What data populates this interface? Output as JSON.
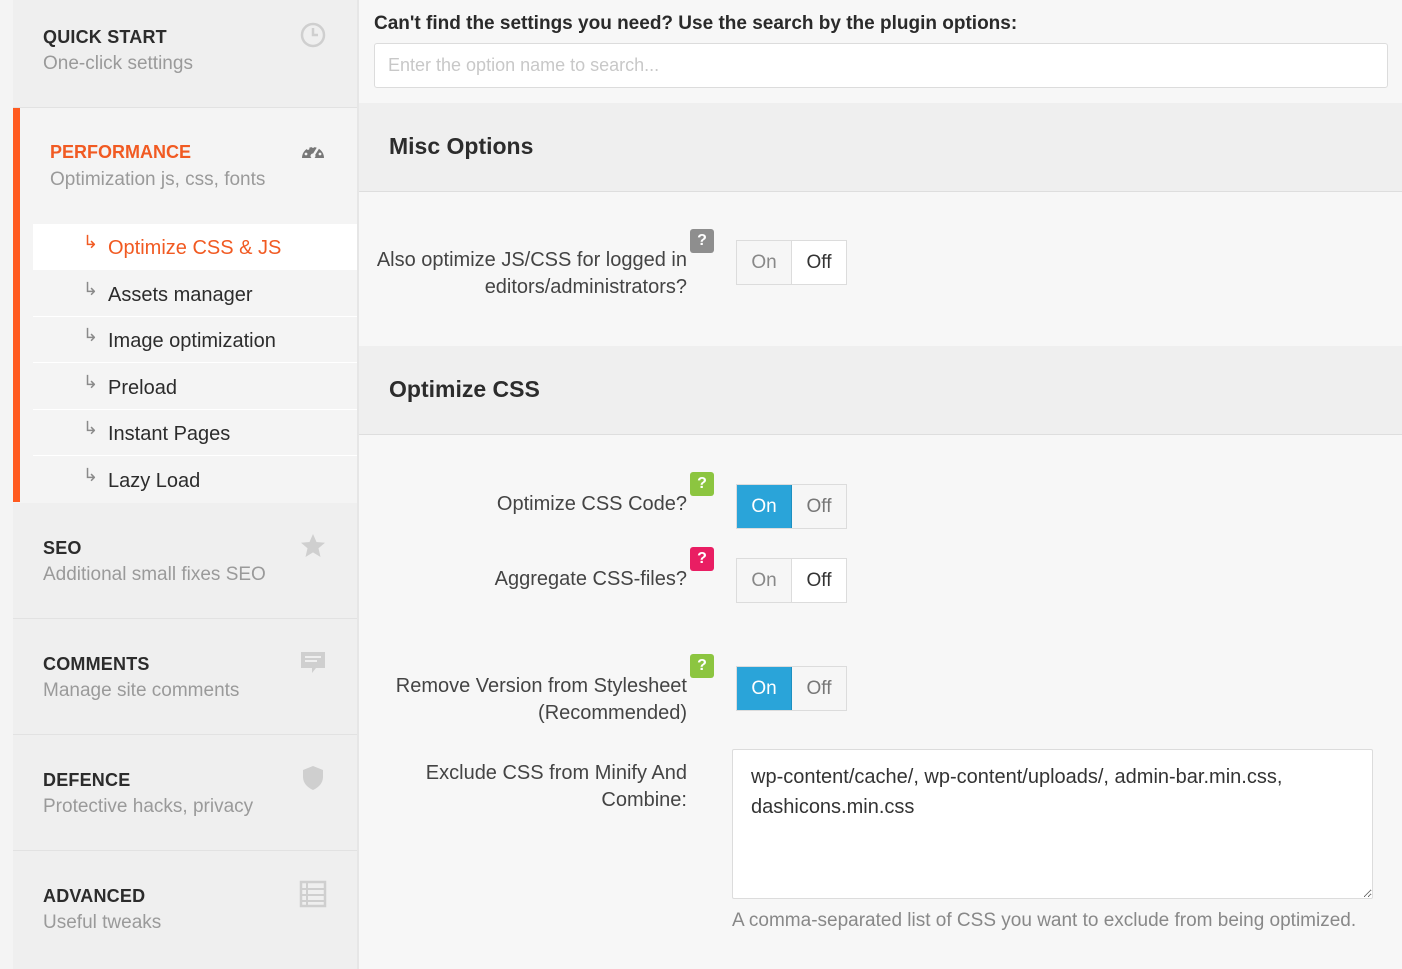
{
  "sidebar": {
    "quick_start": {
      "title": "QUICK START",
      "subtitle": "One-click settings",
      "icon": "clock-icon"
    },
    "performance": {
      "title": "PERFORMANCE",
      "subtitle": "Optimization js, css, fonts",
      "icon": "speedometer-icon",
      "subitems": [
        {
          "label": "Optimize CSS & JS",
          "current": true
        },
        {
          "label": "Assets manager"
        },
        {
          "label": "Image optimization"
        },
        {
          "label": "Preload"
        },
        {
          "label": "Instant Pages"
        },
        {
          "label": "Lazy Load"
        }
      ]
    },
    "seo": {
      "title": "SEO",
      "subtitle": "Additional small fixes SEO",
      "icon": "star-icon"
    },
    "comments": {
      "title": "COMMENTS",
      "subtitle": "Manage site comments",
      "icon": "comment-icon"
    },
    "defence": {
      "title": "DEFENCE",
      "subtitle": "Protective hacks, privacy",
      "icon": "shield-icon"
    },
    "advanced": {
      "title": "ADVANCED",
      "subtitle": "Useful tweaks",
      "icon": "list-icon"
    },
    "arrow_glyph": "↳"
  },
  "search": {
    "label": "Can't find the settings you need? Use the search by the plugin options:",
    "placeholder": "Enter the option name to search..."
  },
  "sections": {
    "misc": {
      "title": "Misc Options",
      "options": {
        "logged_in": {
          "label_line1": "Also optimize JS/CSS for logged in",
          "label_line2": "editors/administrators?",
          "help": "?",
          "state": "off"
        }
      }
    },
    "css": {
      "title": "Optimize CSS",
      "options": {
        "optimize_code": {
          "label": "Optimize CSS Code?",
          "help": "?",
          "state": "on"
        },
        "aggregate": {
          "label": "Aggregate CSS-files?",
          "help": "?",
          "state": "off"
        },
        "remove_version": {
          "label_line1": "Remove Version from Stylesheet",
          "label_line2": "(Recommended)",
          "help": "?",
          "state": "on"
        },
        "exclude": {
          "label_line1": "Exclude CSS from Minify And",
          "label_line2": "Combine:",
          "value": "wp-content/cache/, wp-content/uploads/, admin-bar.min.css, dashicons.min.css",
          "hint": "A comma-separated list of CSS you want to exclude from being optimized."
        }
      }
    }
  },
  "toggle": {
    "on_label": "On",
    "off_label": "Off"
  },
  "colors": {
    "accent": "#f15a22",
    "toggle_on": "#2aa4d9",
    "help_green": "#8cc540",
    "help_pink": "#e91e63",
    "help_gray": "#8e8e8e"
  }
}
